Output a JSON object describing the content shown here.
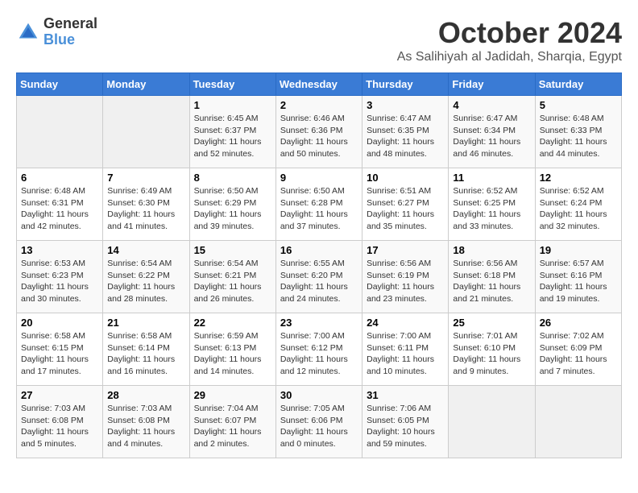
{
  "logo": {
    "general": "General",
    "blue": "Blue"
  },
  "title": "October 2024",
  "location": "As Salihiyah al Jadidah, Sharqia, Egypt",
  "days_header": [
    "Sunday",
    "Monday",
    "Tuesday",
    "Wednesday",
    "Thursday",
    "Friday",
    "Saturday"
  ],
  "weeks": [
    [
      {
        "day": "",
        "info": ""
      },
      {
        "day": "",
        "info": ""
      },
      {
        "day": "1",
        "info": "Sunrise: 6:45 AM\nSunset: 6:37 PM\nDaylight: 11 hours and 52 minutes."
      },
      {
        "day": "2",
        "info": "Sunrise: 6:46 AM\nSunset: 6:36 PM\nDaylight: 11 hours and 50 minutes."
      },
      {
        "day": "3",
        "info": "Sunrise: 6:47 AM\nSunset: 6:35 PM\nDaylight: 11 hours and 48 minutes."
      },
      {
        "day": "4",
        "info": "Sunrise: 6:47 AM\nSunset: 6:34 PM\nDaylight: 11 hours and 46 minutes."
      },
      {
        "day": "5",
        "info": "Sunrise: 6:48 AM\nSunset: 6:33 PM\nDaylight: 11 hours and 44 minutes."
      }
    ],
    [
      {
        "day": "6",
        "info": "Sunrise: 6:48 AM\nSunset: 6:31 PM\nDaylight: 11 hours and 42 minutes."
      },
      {
        "day": "7",
        "info": "Sunrise: 6:49 AM\nSunset: 6:30 PM\nDaylight: 11 hours and 41 minutes."
      },
      {
        "day": "8",
        "info": "Sunrise: 6:50 AM\nSunset: 6:29 PM\nDaylight: 11 hours and 39 minutes."
      },
      {
        "day": "9",
        "info": "Sunrise: 6:50 AM\nSunset: 6:28 PM\nDaylight: 11 hours and 37 minutes."
      },
      {
        "day": "10",
        "info": "Sunrise: 6:51 AM\nSunset: 6:27 PM\nDaylight: 11 hours and 35 minutes."
      },
      {
        "day": "11",
        "info": "Sunrise: 6:52 AM\nSunset: 6:25 PM\nDaylight: 11 hours and 33 minutes."
      },
      {
        "day": "12",
        "info": "Sunrise: 6:52 AM\nSunset: 6:24 PM\nDaylight: 11 hours and 32 minutes."
      }
    ],
    [
      {
        "day": "13",
        "info": "Sunrise: 6:53 AM\nSunset: 6:23 PM\nDaylight: 11 hours and 30 minutes."
      },
      {
        "day": "14",
        "info": "Sunrise: 6:54 AM\nSunset: 6:22 PM\nDaylight: 11 hours and 28 minutes."
      },
      {
        "day": "15",
        "info": "Sunrise: 6:54 AM\nSunset: 6:21 PM\nDaylight: 11 hours and 26 minutes."
      },
      {
        "day": "16",
        "info": "Sunrise: 6:55 AM\nSunset: 6:20 PM\nDaylight: 11 hours and 24 minutes."
      },
      {
        "day": "17",
        "info": "Sunrise: 6:56 AM\nSunset: 6:19 PM\nDaylight: 11 hours and 23 minutes."
      },
      {
        "day": "18",
        "info": "Sunrise: 6:56 AM\nSunset: 6:18 PM\nDaylight: 11 hours and 21 minutes."
      },
      {
        "day": "19",
        "info": "Sunrise: 6:57 AM\nSunset: 6:16 PM\nDaylight: 11 hours and 19 minutes."
      }
    ],
    [
      {
        "day": "20",
        "info": "Sunrise: 6:58 AM\nSunset: 6:15 PM\nDaylight: 11 hours and 17 minutes."
      },
      {
        "day": "21",
        "info": "Sunrise: 6:58 AM\nSunset: 6:14 PM\nDaylight: 11 hours and 16 minutes."
      },
      {
        "day": "22",
        "info": "Sunrise: 6:59 AM\nSunset: 6:13 PM\nDaylight: 11 hours and 14 minutes."
      },
      {
        "day": "23",
        "info": "Sunrise: 7:00 AM\nSunset: 6:12 PM\nDaylight: 11 hours and 12 minutes."
      },
      {
        "day": "24",
        "info": "Sunrise: 7:00 AM\nSunset: 6:11 PM\nDaylight: 11 hours and 10 minutes."
      },
      {
        "day": "25",
        "info": "Sunrise: 7:01 AM\nSunset: 6:10 PM\nDaylight: 11 hours and 9 minutes."
      },
      {
        "day": "26",
        "info": "Sunrise: 7:02 AM\nSunset: 6:09 PM\nDaylight: 11 hours and 7 minutes."
      }
    ],
    [
      {
        "day": "27",
        "info": "Sunrise: 7:03 AM\nSunset: 6:08 PM\nDaylight: 11 hours and 5 minutes."
      },
      {
        "day": "28",
        "info": "Sunrise: 7:03 AM\nSunset: 6:08 PM\nDaylight: 11 hours and 4 minutes."
      },
      {
        "day": "29",
        "info": "Sunrise: 7:04 AM\nSunset: 6:07 PM\nDaylight: 11 hours and 2 minutes."
      },
      {
        "day": "30",
        "info": "Sunrise: 7:05 AM\nSunset: 6:06 PM\nDaylight: 11 hours and 0 minutes."
      },
      {
        "day": "31",
        "info": "Sunrise: 7:06 AM\nSunset: 6:05 PM\nDaylight: 10 hours and 59 minutes."
      },
      {
        "day": "",
        "info": ""
      },
      {
        "day": "",
        "info": ""
      }
    ]
  ]
}
